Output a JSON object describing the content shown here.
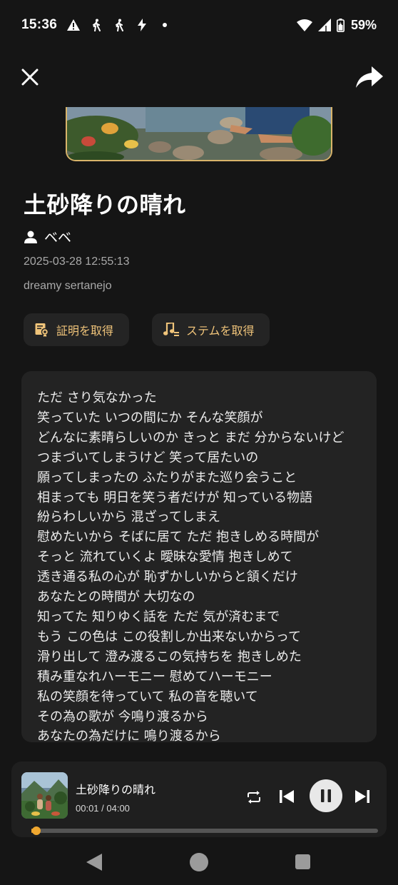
{
  "status_bar": {
    "time": "15:36",
    "battery_pct": "59%",
    "icons": [
      "warning-icon",
      "walking-icon",
      "walking-icon",
      "bolt-icon",
      "dot-icon",
      "wifi-icon",
      "signal-icon",
      "battery-icon"
    ]
  },
  "nav": {
    "close_icon": "close-icon",
    "share_icon": "share-icon"
  },
  "song": {
    "title": "土砂降りの晴れ",
    "artist": "ベベ",
    "date": "2025-03-28 12:55:13",
    "genre": "dreamy sertanejo"
  },
  "actions": {
    "proof_label": "証明を取得",
    "stem_label": "ステムを取得"
  },
  "lyrics": [
    "ただ さり気なかった",
    "笑っていた いつの間にか そんな笑顔が",
    "どんなに素晴らしいのか きっと まだ 分からないけど",
    "つまづいてしまうけど 笑って居たいの",
    "願ってしまったの ふたりがまた巡り会うこと",
    "相まっても 明日を笑う者だけが 知っている物語",
    "紛らわしいから 混ざってしまえ",
    "慰めたいから そばに居て ただ 抱きしめる時間が",
    "そっと 流れていくよ 曖昧な愛情 抱きしめて",
    "透き通る私の心が 恥ずかしいからと頷くだけ",
    "あなたとの時間が 大切なの",
    "知ってた 知りゆく話を ただ 気が済むまで",
    "もう この色は この役割しか出来ないからって",
    "滑り出して 澄み渡るこの気持ちを 抱きしめた",
    "積み重なれハーモニー 慰めてハーモニー",
    "私の笑顔を待っていて 私の音を聴いて",
    "その為の歌が 今鳴り渡るから",
    "あなたの為だけに 鳴り渡るから"
  ],
  "player": {
    "title": "土砂降りの晴れ",
    "time": "00:01 / 04:00",
    "progress": 0.004,
    "accent_color": "#f0a830"
  },
  "system_nav": {
    "back_icon": "back-icon",
    "home_icon": "home-icon",
    "recents_icon": "recents-icon"
  }
}
